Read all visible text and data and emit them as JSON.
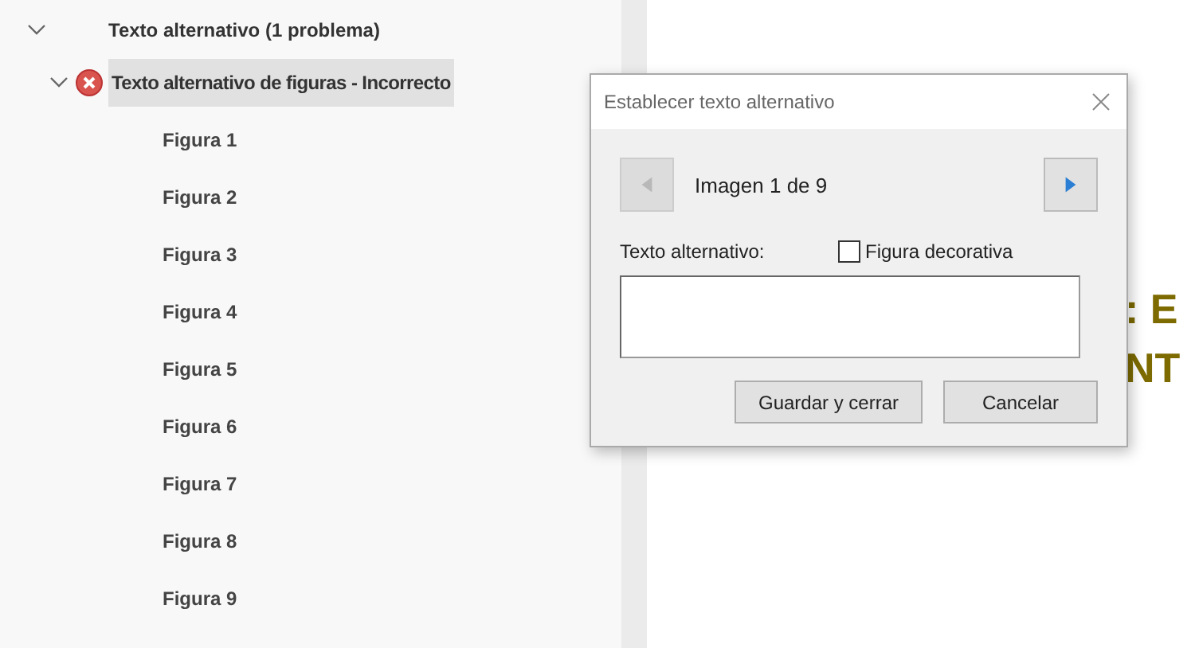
{
  "tree": [
    {
      "label": "Texto alternativo (1 problema)",
      "expanded": true,
      "selected": false,
      "children": [
        {
          "label": "Texto alternativo de figuras - Incorrecto",
          "expanded": true,
          "selected": true,
          "has_error": true,
          "children": [
            {
              "label": "Figura 1",
              "selected": false
            },
            {
              "label": "Figura 2",
              "selected": false
            },
            {
              "label": "Figura 3",
              "selected": false
            },
            {
              "label": "Figura 4",
              "selected": false
            },
            {
              "label": "Figura 5",
              "selected": false
            },
            {
              "label": "Figura 6",
              "selected": false
            },
            {
              "label": "Figura 7",
              "selected": false
            },
            {
              "label": "Figura 8",
              "selected": false
            },
            {
              "label": "Figura 9",
              "selected": false
            }
          ]
        }
      ]
    }
  ],
  "document": {
    "lines": [
      ": E",
      "NT"
    ]
  },
  "dialog": {
    "title": "Establecer texto alternativo",
    "prev_disabled": true,
    "next_disabled": false,
    "counter": "Imagen 1 de 9",
    "field_label": "Texto alternativo:",
    "checkbox": {
      "label": "Figura decorativa",
      "checked": false
    },
    "buttons": [
      "Guardar y cerrar",
      "Cancelar"
    ]
  }
}
